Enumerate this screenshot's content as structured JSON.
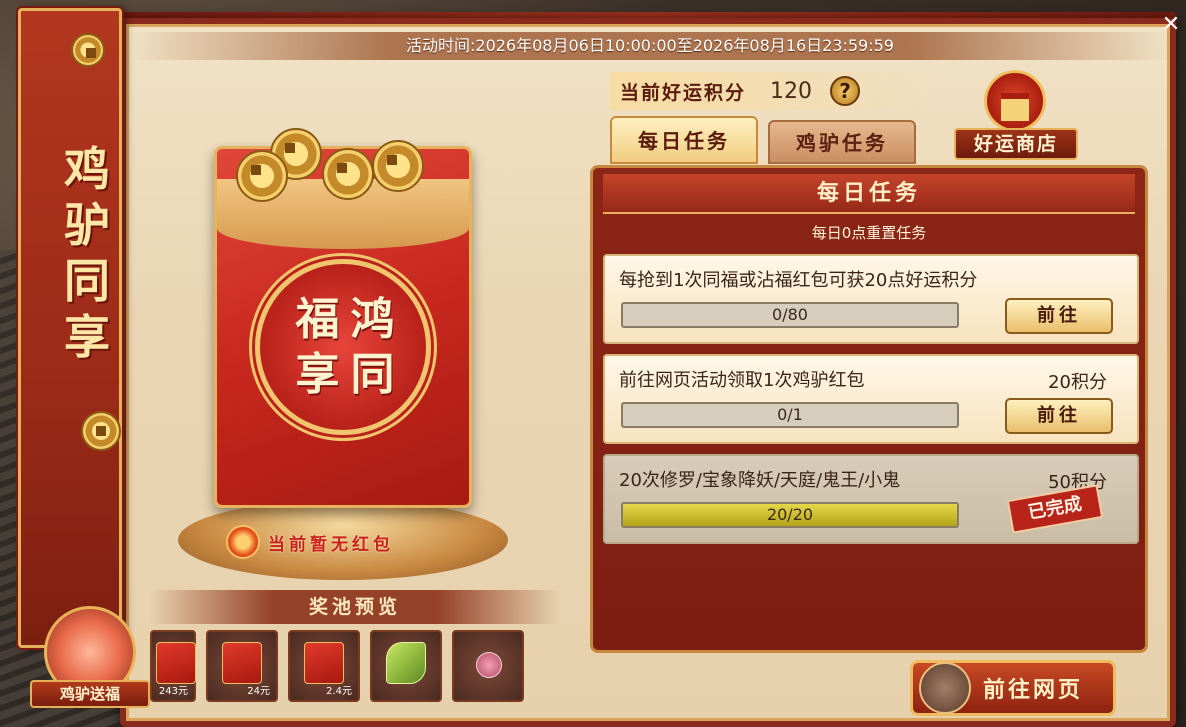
{
  "activity_time": "活动时间:2026年08月06日10:00:00至2026年08月16日23:59:59",
  "banner": {
    "title": "鸡驴同享"
  },
  "envelope": {
    "seal_chars": [
      "鸿",
      "福",
      "同",
      "享"
    ],
    "status": "当前暂无红包"
  },
  "pool": {
    "title": "奖池预览",
    "items": [
      {
        "icon": "red-packet-icon",
        "amount": "243元"
      },
      {
        "icon": "red-packet-icon",
        "amount": "24元"
      },
      {
        "icon": "red-packet-icon",
        "amount": "2.4元"
      },
      {
        "icon": "leaf-item-icon",
        "amount": ""
      },
      {
        "icon": "pink-gem-icon",
        "amount": ""
      }
    ]
  },
  "donkey_button": {
    "label": "鸡驴送福"
  },
  "points": {
    "label": "当前好运积分",
    "value": "120",
    "help": "?"
  },
  "shop": {
    "label": "好运商店"
  },
  "tabs": [
    {
      "label": "每日任务",
      "active": true
    },
    {
      "label": "鸡驴任务",
      "active": false
    }
  ],
  "task_panel": {
    "title": "每日任务",
    "subtitle": "每日0点重置任务",
    "tasks": [
      {
        "name": "每抢到1次同福或沾福红包可获20点好运积分",
        "points": "",
        "progress_text": "0/80",
        "progress": 0,
        "action": "前往",
        "done": false
      },
      {
        "name": "前往网页活动领取1次鸡驴红包",
        "points": "20积分",
        "progress_text": "0/1",
        "progress": 0,
        "action": "前往",
        "done": false
      },
      {
        "name": "20次修罗/宝象降妖/天庭/鬼王/小鬼",
        "points": "50积分",
        "progress_text": "20/20",
        "progress": 1,
        "action": "已完成",
        "done": true
      }
    ]
  },
  "go_web": {
    "label": "前往网页"
  },
  "colors": {
    "primary_red": "#8c2616",
    "gold": "#e6b15a",
    "progress_fill": "#c8b82a"
  }
}
